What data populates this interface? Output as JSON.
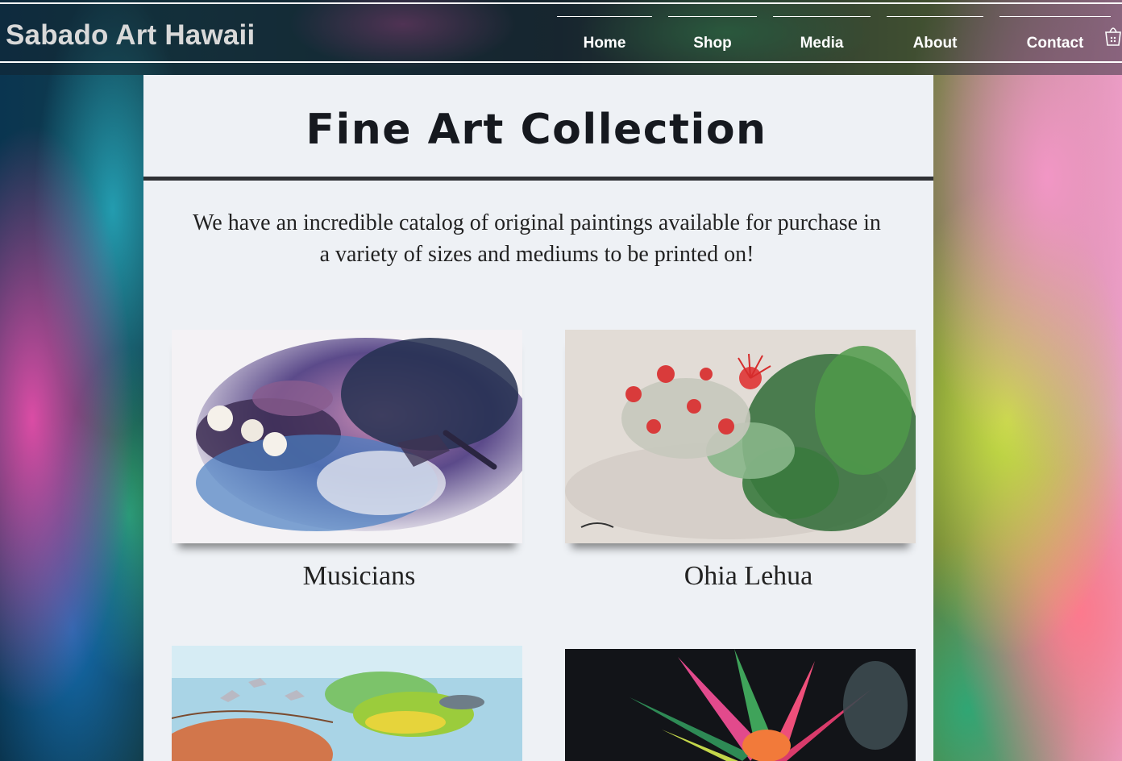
{
  "header": {
    "brand": "Sabado Art Hawaii",
    "nav": [
      "Home",
      "Shop",
      "Media",
      "About",
      "Contact"
    ],
    "cart_icon": "cart-icon"
  },
  "main": {
    "title": "Fine Art Collection",
    "intro": "We have an incredible catalog of original paintings available for purchase in a variety of sizes and mediums to be printed on!",
    "collections": [
      {
        "caption": "Musicians",
        "icon": "musician-painting"
      },
      {
        "caption": "Ohia Lehua",
        "icon": "ohia-lehua-painting"
      },
      {
        "caption": "",
        "icon": "ocean-fish-painting"
      },
      {
        "caption": "",
        "icon": "ti-leaf-painting"
      }
    ]
  }
}
